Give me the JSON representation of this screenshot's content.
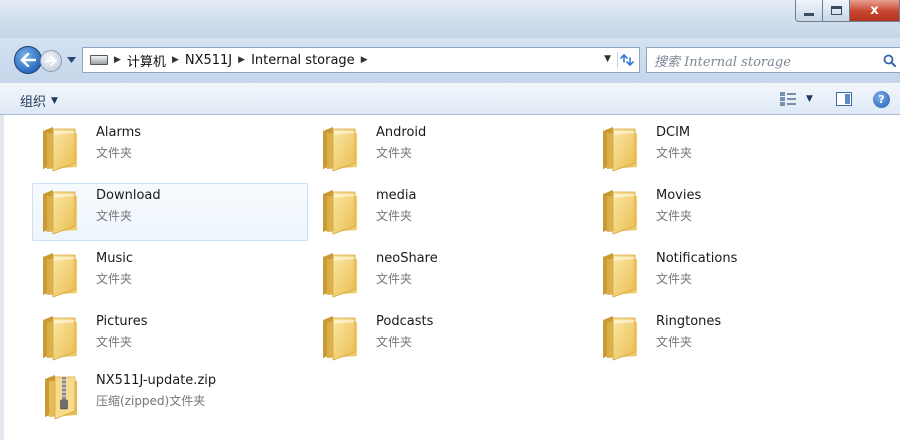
{
  "window": {
    "caption_close": "x",
    "caption_max": "",
    "caption_min": ""
  },
  "nav": {
    "breadcrumbs": [
      "计算机",
      "NX511J",
      "Internal storage"
    ],
    "search_placeholder": "搜索 Internal storage"
  },
  "toolbar": {
    "organize_label": "组织",
    "help_label": "?"
  },
  "items": [
    {
      "name": "Alarms",
      "type": "文件夹",
      "kind": "folder",
      "selected": false
    },
    {
      "name": "Android",
      "type": "文件夹",
      "kind": "folder",
      "selected": false
    },
    {
      "name": "DCIM",
      "type": "文件夹",
      "kind": "folder",
      "selected": false
    },
    {
      "name": "Download",
      "type": "文件夹",
      "kind": "folder",
      "selected": true
    },
    {
      "name": "media",
      "type": "文件夹",
      "kind": "folder",
      "selected": false
    },
    {
      "name": "Movies",
      "type": "文件夹",
      "kind": "folder",
      "selected": false
    },
    {
      "name": "Music",
      "type": "文件夹",
      "kind": "folder",
      "selected": false
    },
    {
      "name": "neoShare",
      "type": "文件夹",
      "kind": "folder",
      "selected": false
    },
    {
      "name": "Notifications",
      "type": "文件夹",
      "kind": "folder",
      "selected": false
    },
    {
      "name": "Pictures",
      "type": "文件夹",
      "kind": "folder",
      "selected": false
    },
    {
      "name": "Podcasts",
      "type": "文件夹",
      "kind": "folder",
      "selected": false
    },
    {
      "name": "Ringtones",
      "type": "文件夹",
      "kind": "folder",
      "selected": false
    },
    {
      "name": "NX511J-update.zip",
      "type": "压缩(zipped)文件夹",
      "kind": "zip",
      "selected": false
    }
  ],
  "colors": {
    "folder": "#f2cf6b",
    "selection_border": "#cfe0f1",
    "close_button": "#c8442d"
  }
}
